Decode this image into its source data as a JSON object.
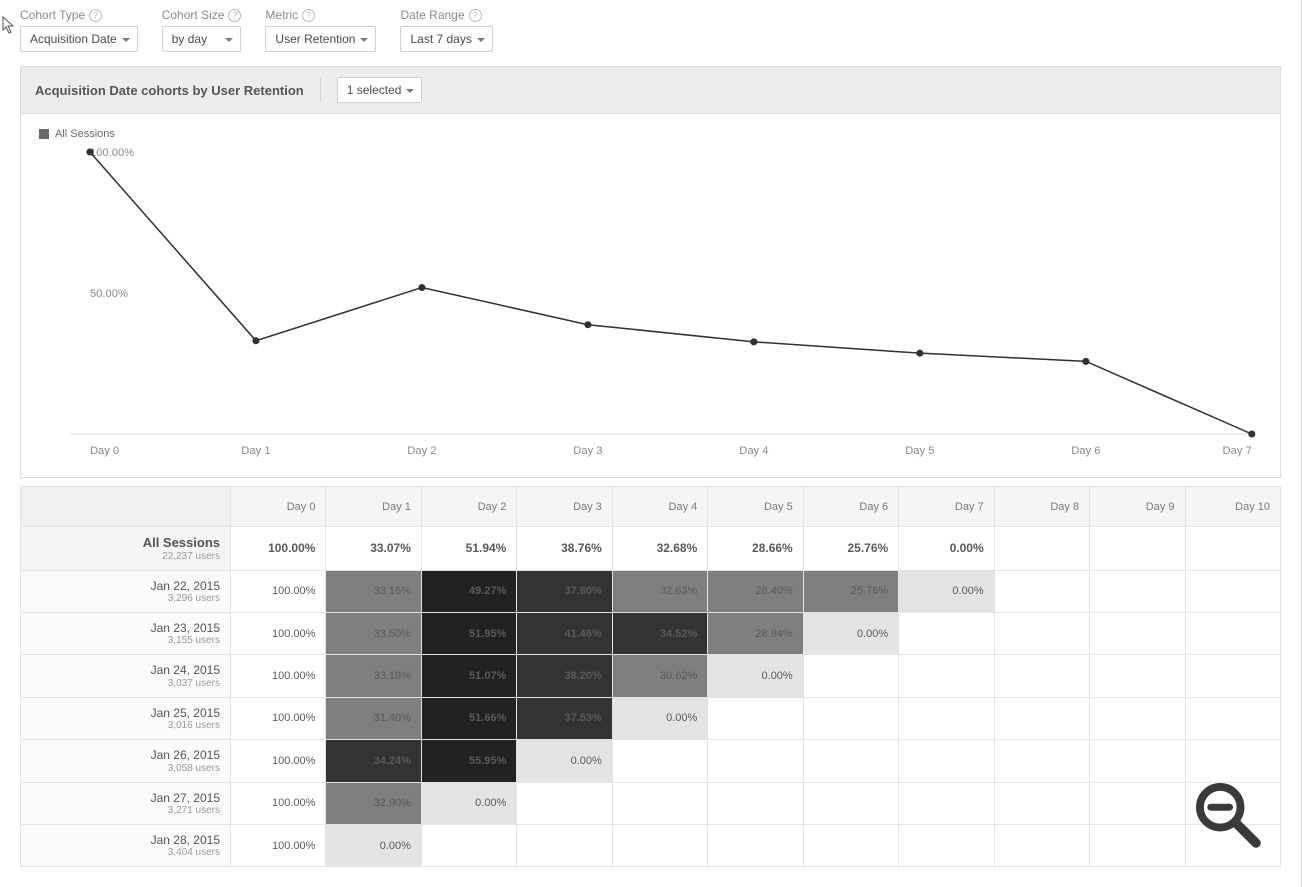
{
  "selectors": {
    "cohort_type": {
      "label": "Cohort Type",
      "value": "Acquisition Date"
    },
    "cohort_size": {
      "label": "Cohort Size",
      "value": "by day"
    },
    "metric": {
      "label": "Metric",
      "value": "User Retention"
    },
    "date_range": {
      "label": "Date Range",
      "value": "Last 7 days"
    }
  },
  "panel": {
    "title": "Acquisition Date cohorts by User Retention",
    "filter_label": "1 selected"
  },
  "legend": {
    "series_name": "All Sessions"
  },
  "chart_data": {
    "type": "line",
    "title": "",
    "xlabel": "",
    "ylabel": "",
    "x_categories": [
      "Day 0",
      "Day 1",
      "Day 2",
      "Day 3",
      "Day 4",
      "Day 5",
      "Day 6",
      "Day 7"
    ],
    "y_ticks": [
      50,
      100
    ],
    "y_tick_labels": [
      "50.00%",
      "100.00%"
    ],
    "ylim": [
      0,
      100
    ],
    "series": [
      {
        "name": "All Sessions",
        "values": [
          100.0,
          33.07,
          51.94,
          38.76,
          32.68,
          28.66,
          25.76,
          0.0
        ]
      }
    ]
  },
  "table": {
    "columns": [
      "Day 0",
      "Day 1",
      "Day 2",
      "Day 3",
      "Day 4",
      "Day 5",
      "Day 6",
      "Day 7",
      "Day 8",
      "Day 9",
      "Day 10"
    ],
    "total_row": {
      "label": "All Sessions",
      "sub": "22,237 users",
      "cells": [
        "100.00%",
        "33.07%",
        "51.94%",
        "38.76%",
        "32.68%",
        "28.66%",
        "25.76%",
        "0.00%",
        "",
        "",
        ""
      ]
    },
    "rows": [
      {
        "label": "Jan 22, 2015",
        "sub": "3,296 users",
        "cells": [
          {
            "v": "100.00%",
            "s": 0
          },
          {
            "v": "33.16%",
            "s": 2
          },
          {
            "v": "49.27%",
            "s": 5
          },
          {
            "v": "37.80%",
            "s": 4
          },
          {
            "v": "32.83%",
            "s": 2
          },
          {
            "v": "28.40%",
            "s": 2
          },
          {
            "v": "25.76%",
            "s": 2
          },
          {
            "v": "0.00%",
            "s": 1
          },
          {
            "v": "",
            "s": 0
          },
          {
            "v": "",
            "s": 0
          },
          {
            "v": "",
            "s": 0
          }
        ]
      },
      {
        "label": "Jan 23, 2015",
        "sub": "3,155 users",
        "cells": [
          {
            "v": "100.00%",
            "s": 0
          },
          {
            "v": "33.50%",
            "s": 2
          },
          {
            "v": "51.95%",
            "s": 5
          },
          {
            "v": "41.46%",
            "s": 4
          },
          {
            "v": "34.52%",
            "s": 4
          },
          {
            "v": "28.94%",
            "s": 2
          },
          {
            "v": "0.00%",
            "s": 1
          },
          {
            "v": "",
            "s": 0
          },
          {
            "v": "",
            "s": 0
          },
          {
            "v": "",
            "s": 0
          },
          {
            "v": "",
            "s": 0
          }
        ]
      },
      {
        "label": "Jan 24, 2015",
        "sub": "3,037 users",
        "cells": [
          {
            "v": "100.00%",
            "s": 0
          },
          {
            "v": "33.19%",
            "s": 2
          },
          {
            "v": "51.07%",
            "s": 5
          },
          {
            "v": "38.20%",
            "s": 4
          },
          {
            "v": "30.62%",
            "s": 2
          },
          {
            "v": "0.00%",
            "s": 1
          },
          {
            "v": "",
            "s": 0
          },
          {
            "v": "",
            "s": 0
          },
          {
            "v": "",
            "s": 0
          },
          {
            "v": "",
            "s": 0
          },
          {
            "v": "",
            "s": 0
          }
        ]
      },
      {
        "label": "Jan 25, 2015",
        "sub": "3,016 users",
        "cells": [
          {
            "v": "100.00%",
            "s": 0
          },
          {
            "v": "31.40%",
            "s": 2
          },
          {
            "v": "51.66%",
            "s": 5
          },
          {
            "v": "37.53%",
            "s": 4
          },
          {
            "v": "0.00%",
            "s": 1
          },
          {
            "v": "",
            "s": 0
          },
          {
            "v": "",
            "s": 0
          },
          {
            "v": "",
            "s": 0
          },
          {
            "v": "",
            "s": 0
          },
          {
            "v": "",
            "s": 0
          },
          {
            "v": "",
            "s": 0
          }
        ]
      },
      {
        "label": "Jan 26, 2015",
        "sub": "3,058 users",
        "cells": [
          {
            "v": "100.00%",
            "s": 0
          },
          {
            "v": "34.24%",
            "s": 4
          },
          {
            "v": "55.95%",
            "s": 5
          },
          {
            "v": "0.00%",
            "s": 1
          },
          {
            "v": "",
            "s": 0
          },
          {
            "v": "",
            "s": 0
          },
          {
            "v": "",
            "s": 0
          },
          {
            "v": "",
            "s": 0
          },
          {
            "v": "",
            "s": 0
          },
          {
            "v": "",
            "s": 0
          },
          {
            "v": "",
            "s": 0
          }
        ]
      },
      {
        "label": "Jan 27, 2015",
        "sub": "3,271 users",
        "cells": [
          {
            "v": "100.00%",
            "s": 0
          },
          {
            "v": "32.90%",
            "s": 2
          },
          {
            "v": "0.00%",
            "s": 1
          },
          {
            "v": "",
            "s": 0
          },
          {
            "v": "",
            "s": 0
          },
          {
            "v": "",
            "s": 0
          },
          {
            "v": "",
            "s": 0
          },
          {
            "v": "",
            "s": 0
          },
          {
            "v": "",
            "s": 0
          },
          {
            "v": "",
            "s": 0
          },
          {
            "v": "",
            "s": 0
          }
        ]
      },
      {
        "label": "Jan 28, 2015",
        "sub": "3,404 users",
        "cells": [
          {
            "v": "100.00%",
            "s": 0
          },
          {
            "v": "0.00%",
            "s": 1
          },
          {
            "v": "",
            "s": 0
          },
          {
            "v": "",
            "s": 0
          },
          {
            "v": "",
            "s": 0
          },
          {
            "v": "",
            "s": 0
          },
          {
            "v": "",
            "s": 0
          },
          {
            "v": "",
            "s": 0
          },
          {
            "v": "",
            "s": 0
          },
          {
            "v": "",
            "s": 0
          },
          {
            "v": "",
            "s": 0
          }
        ]
      }
    ]
  }
}
